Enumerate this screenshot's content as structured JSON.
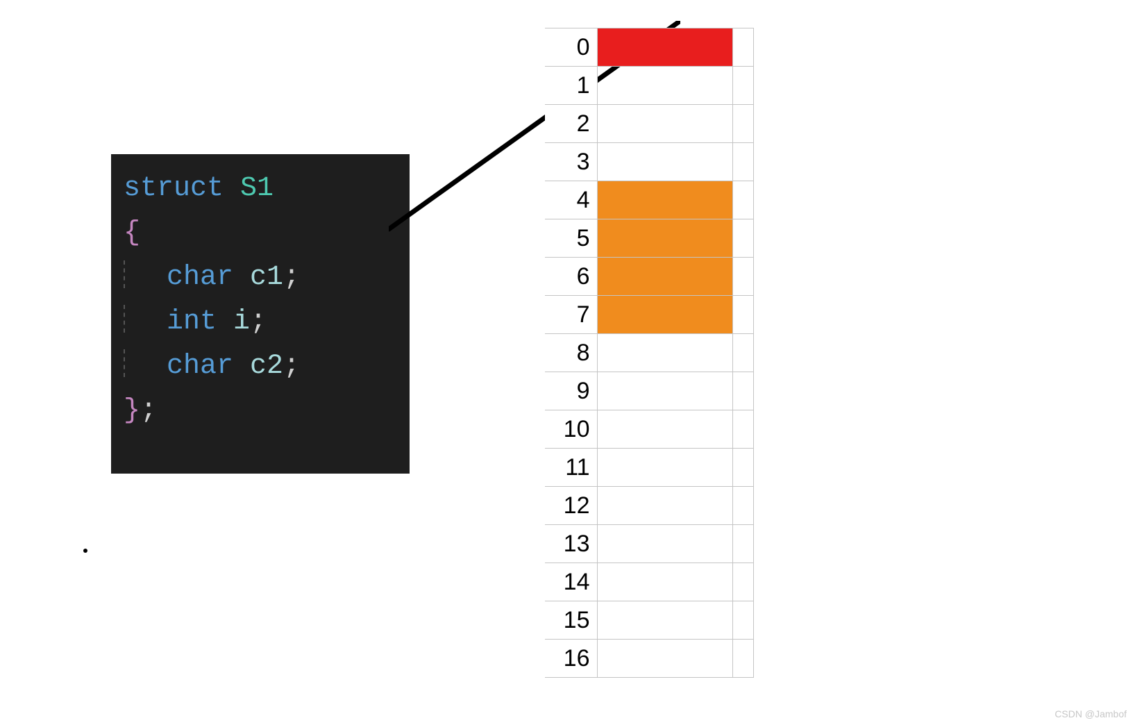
{
  "code": {
    "kw_struct": "struct",
    "typename": "S1",
    "brace_open": "{",
    "lines": [
      {
        "type": "char",
        "var": "c1",
        "semi": ";"
      },
      {
        "type": "int",
        "var": "i",
        "semi": ";"
      },
      {
        "type": "char",
        "var": "c2",
        "semi": ";"
      }
    ],
    "brace_close": "}",
    "end_semi": ";"
  },
  "memory": {
    "rows": [
      {
        "index": "0",
        "color": "red"
      },
      {
        "index": "1",
        "color": ""
      },
      {
        "index": "2",
        "color": ""
      },
      {
        "index": "3",
        "color": ""
      },
      {
        "index": "4",
        "color": "orange"
      },
      {
        "index": "5",
        "color": "orange"
      },
      {
        "index": "6",
        "color": "orange"
      },
      {
        "index": "7",
        "color": "orange"
      },
      {
        "index": "8",
        "color": ""
      },
      {
        "index": "9",
        "color": ""
      },
      {
        "index": "10",
        "color": ""
      },
      {
        "index": "11",
        "color": ""
      },
      {
        "index": "12",
        "color": ""
      },
      {
        "index": "13",
        "color": ""
      },
      {
        "index": "14",
        "color": ""
      },
      {
        "index": "15",
        "color": ""
      },
      {
        "index": "16",
        "color": ""
      }
    ]
  },
  "watermark": "CSDN @Jambof",
  "chart_data": {
    "type": "table",
    "title": "struct S1 memory layout",
    "members": [
      {
        "name": "c1",
        "ctype": "char",
        "offset": 0,
        "size": 1,
        "color": "#e81e1e"
      },
      {
        "name": "i",
        "ctype": "int",
        "offset": 4,
        "size": 4,
        "color": "#f08c1e"
      },
      {
        "name": "c2",
        "ctype": "char",
        "offset": 8,
        "size": 1,
        "color": ""
      }
    ],
    "byte_indices": [
      0,
      1,
      2,
      3,
      4,
      5,
      6,
      7,
      8,
      9,
      10,
      11,
      12,
      13,
      14,
      15,
      16
    ],
    "highlighted_bytes": {
      "0": "red",
      "4": "orange",
      "5": "orange",
      "6": "orange",
      "7": "orange"
    }
  }
}
